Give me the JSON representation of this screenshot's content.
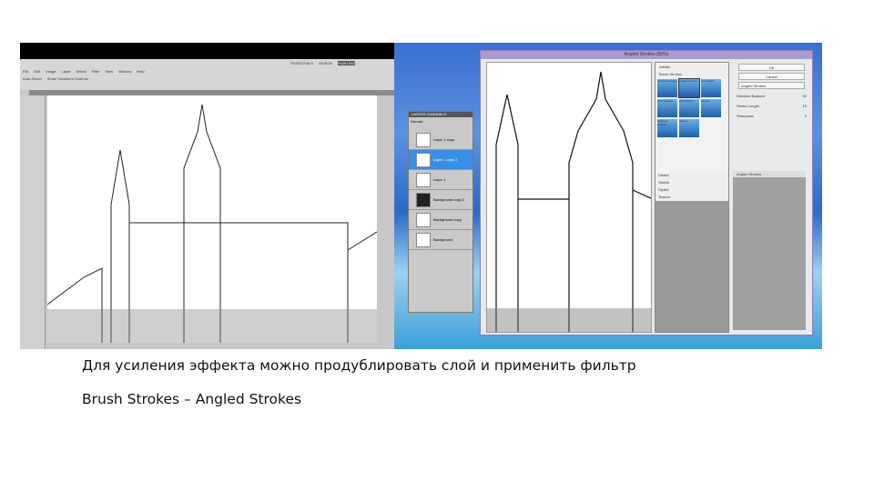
{
  "photoshop": {
    "menu": [
      "File",
      "Edit",
      "Image",
      "Layer",
      "Select",
      "Filter",
      "View",
      "Window",
      "Help"
    ],
    "workspace": [
      "ESSENTIALS",
      "DESIGN",
      "PAINTING"
    ],
    "option_auto_select": "Auto-Select",
    "option_transform": "Show Transform Controls"
  },
  "layers_panel": {
    "tabs": [
      "LAYERS",
      "CHANNELS"
    ],
    "blend_mode": "Normal",
    "layers": [
      "Layer 1 copy",
      "Layer 1 copy 2",
      "Layer 1",
      "Background copy 2",
      "Background copy",
      "Background"
    ]
  },
  "filter_dialog": {
    "title": "Angled Strokes (50%)",
    "ok": "OK",
    "cancel": "Cancel",
    "selected_filter": "Angled Strokes",
    "categories_top": [
      "Artistic",
      "Brush Strokes"
    ],
    "thumbs": [
      "Accented Edges",
      "Angled Strokes",
      "Crosshatch",
      "Dark Strokes",
      "Ink Outlines",
      "Spatter",
      "Sprayed Strokes",
      "Sumi-e"
    ],
    "categories_bottom": [
      "Distort",
      "Sketch",
      "Stylize",
      "Texture"
    ],
    "params": [
      {
        "label": "Direction Balance",
        "value": "50"
      },
      {
        "label": "Stroke Length",
        "value": "15"
      },
      {
        "label": "Sharpness",
        "value": "3"
      }
    ],
    "effect_layer": "Angled Strokes"
  },
  "caption": {
    "line1": "Для усиления эффекта можно продублировать слой и применить фильтр",
    "line2": "Brush Strokes – Angled Strokes"
  }
}
